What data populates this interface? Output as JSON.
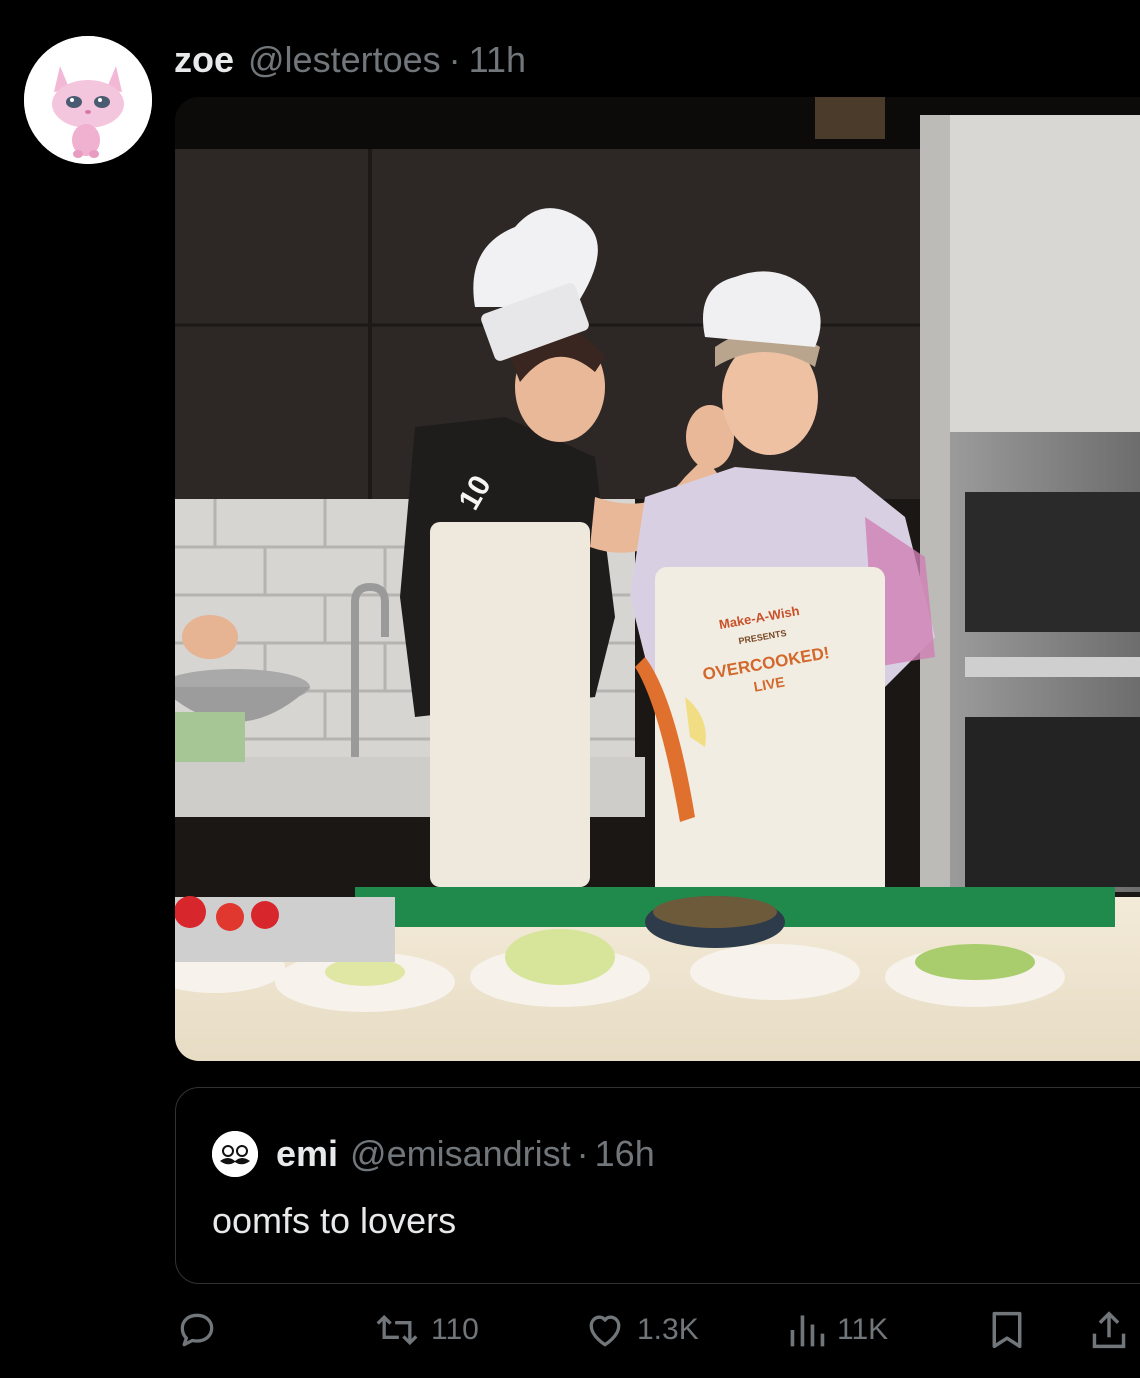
{
  "post": {
    "display_name": "zoe",
    "handle": "@lestertoes",
    "separator": "·",
    "time": "11h",
    "avatar_icon": "pink-kitten-avatar",
    "media": {
      "overlay_text_number": "10",
      "apron_text_line1": "Make-A-Wish",
      "apron_text_line2": "PRESENTS",
      "apron_text_line3": "OVERCOOKED!",
      "apron_text_line4": "LIVE"
    }
  },
  "quote": {
    "display_name": "emi",
    "handle": "@emisandrist",
    "separator": "·",
    "time": "16h",
    "text": "oomfs to lovers",
    "avatar_icon": "mustache-face-avatar"
  },
  "actions": {
    "reply": {
      "icon": "reply-icon",
      "count": ""
    },
    "repost": {
      "icon": "repost-icon",
      "count": "110"
    },
    "like": {
      "icon": "heart-icon",
      "count": "1.3K"
    },
    "views": {
      "icon": "views-chart-icon",
      "count": "11K"
    },
    "bookmark": {
      "icon": "bookmark-icon"
    },
    "share": {
      "icon": "share-icon"
    }
  },
  "colors": {
    "background": "#000000",
    "primary_text": "#e7e9ea",
    "secondary_text": "#71767b",
    "border": "#2f3336"
  }
}
